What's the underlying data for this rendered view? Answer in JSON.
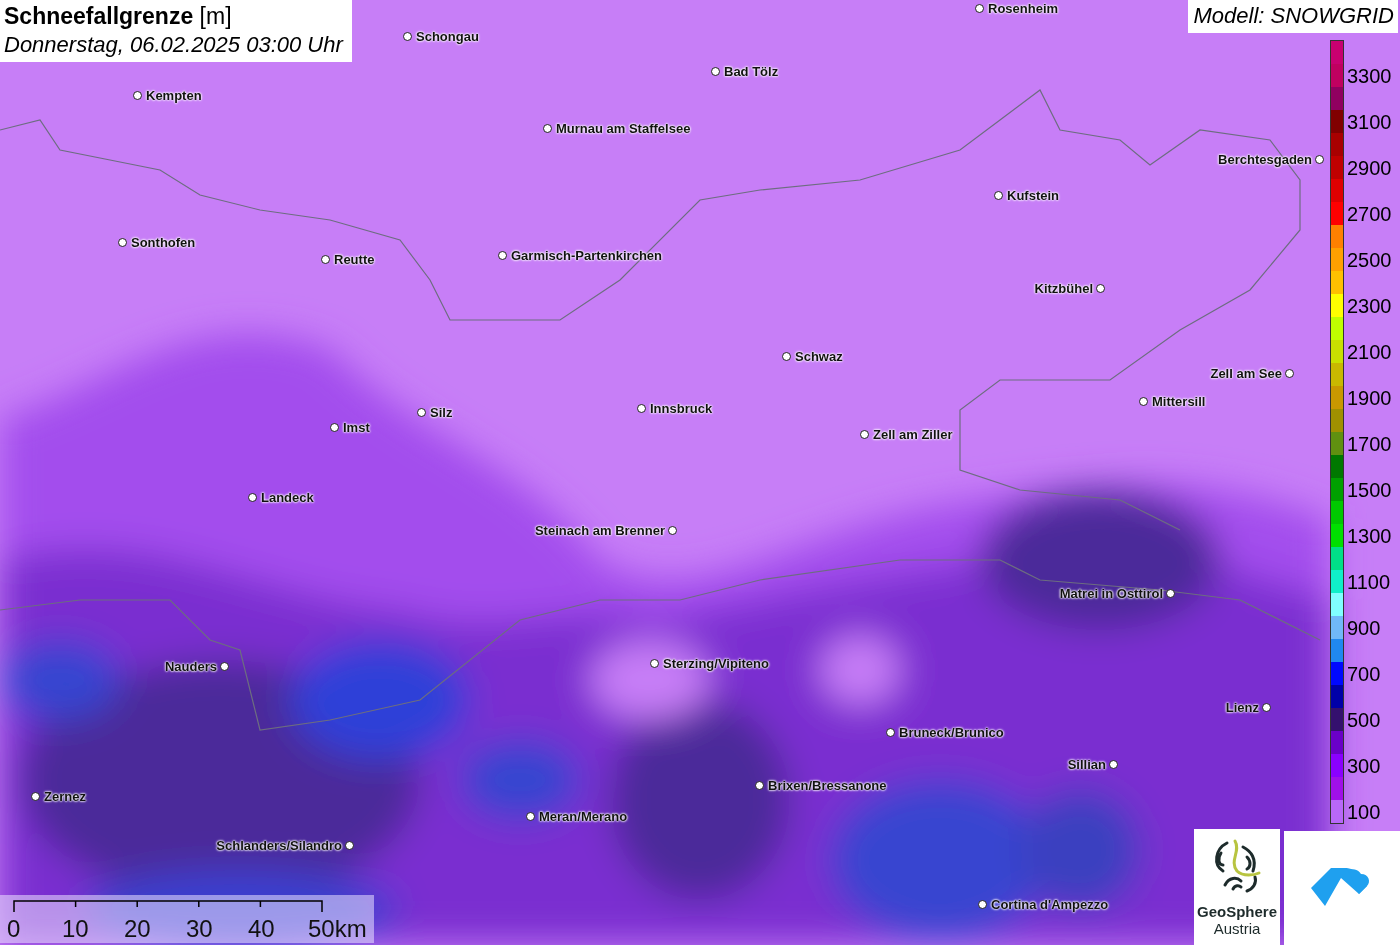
{
  "title": {
    "name": "Schneefallgrenze",
    "unit": "[m]",
    "date": "Donnerstag, 06.02.2025 03:00 Uhr"
  },
  "model": "Modell: SNOWGRID",
  "cities": [
    {
      "name": "Rosenheim"
    },
    {
      "name": "Schongau"
    },
    {
      "name": "Bad Tölz"
    },
    {
      "name": "Kempten"
    },
    {
      "name": "Murnau am Staffelsee"
    },
    {
      "name": "Berchtesgaden"
    },
    {
      "name": "Kufstein"
    },
    {
      "name": "Sonthofen"
    },
    {
      "name": "Reutte"
    },
    {
      "name": "Garmisch-Partenkirchen"
    },
    {
      "name": "Kitzbühel"
    },
    {
      "name": "Schwaz"
    },
    {
      "name": "Zell am See"
    },
    {
      "name": "Mittersill"
    },
    {
      "name": "Imst"
    },
    {
      "name": "Silz"
    },
    {
      "name": "Innsbruck"
    },
    {
      "name": "Zell am Ziller"
    },
    {
      "name": "Landeck"
    },
    {
      "name": "Steinach am Brenner"
    },
    {
      "name": "Matrei in Osttirol"
    },
    {
      "name": "Nauders"
    },
    {
      "name": "Sterzing/Vipiteno"
    },
    {
      "name": "Lienz"
    },
    {
      "name": "Bruneck/Brunico"
    },
    {
      "name": "Sillian"
    },
    {
      "name": "Zernez"
    },
    {
      "name": "Brixen/Bressanone"
    },
    {
      "name": "Meran/Merano"
    },
    {
      "name": "Schlanders/Silandro"
    },
    {
      "name": "Cortina d'Ampezzo"
    }
  ],
  "legend": [
    {
      "color": "#c80070"
    },
    {
      "color": "#c00060",
      "label": "3300"
    },
    {
      "color": "#900060"
    },
    {
      "color": "#800000",
      "label": "3100"
    },
    {
      "color": "#a80000"
    },
    {
      "color": "#c00000",
      "label": "2900"
    },
    {
      "color": "#e00000"
    },
    {
      "color": "#ff0000",
      "label": "2700"
    },
    {
      "color": "#ff8000"
    },
    {
      "color": "#ffa000",
      "label": "2500"
    },
    {
      "color": "#ffc000"
    },
    {
      "color": "#ffff00",
      "label": "2300"
    },
    {
      "color": "#c0ff00"
    },
    {
      "color": "#c8e000",
      "label": "2100"
    },
    {
      "color": "#c8b800"
    },
    {
      "color": "#c89800",
      "label": "1900"
    },
    {
      "color": "#a09000"
    },
    {
      "color": "#609010",
      "label": "1700"
    },
    {
      "color": "#007800"
    },
    {
      "color": "#00a000",
      "label": "1500"
    },
    {
      "color": "#00c800"
    },
    {
      "color": "#00e000",
      "label": "1300"
    },
    {
      "color": "#00e088"
    },
    {
      "color": "#10f0c8",
      "label": "1100"
    },
    {
      "color": "#80ffff"
    },
    {
      "color": "#70b8f8",
      "label": "900"
    },
    {
      "color": "#2088f0"
    },
    {
      "color": "#0008ff",
      "label": "700"
    },
    {
      "color": "#0000a8"
    },
    {
      "color": "#34106e",
      "label": "500"
    },
    {
      "color": "#6a00c8"
    },
    {
      "color": "#8a00ff",
      "label": "300"
    },
    {
      "color": "#a010e8"
    },
    {
      "color": "#b868f8",
      "label": "100"
    }
  ],
  "scale": {
    "ticks": [
      "0",
      "10",
      "20",
      "30",
      "40",
      "50km"
    ]
  },
  "logos": {
    "geosphere": {
      "line1": "GeoSphere",
      "line2": "Austria"
    }
  }
}
